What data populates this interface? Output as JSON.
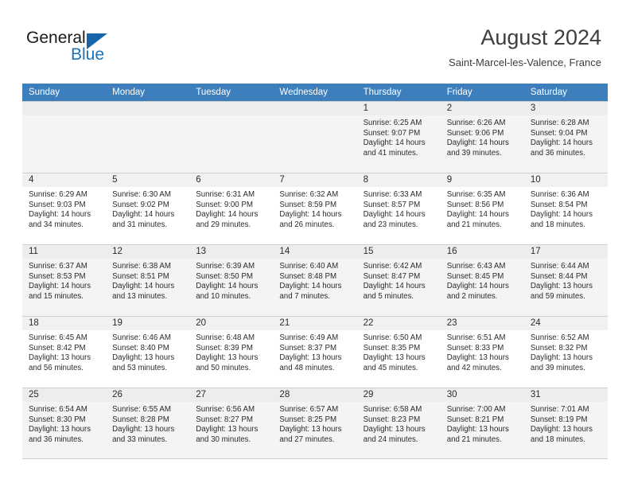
{
  "brand": {
    "name_part1": "General",
    "name_part2": "Blue",
    "accent_color": "#1c72b8"
  },
  "header": {
    "title": "August 2024",
    "location": "Saint-Marcel-les-Valence, France"
  },
  "calendar": {
    "header_bg": "#3d7ebd",
    "weekdays": [
      "Sunday",
      "Monday",
      "Tuesday",
      "Wednesday",
      "Thursday",
      "Friday",
      "Saturday"
    ],
    "weeks": [
      [
        {
          "day": "",
          "empty": true
        },
        {
          "day": "",
          "empty": true
        },
        {
          "day": "",
          "empty": true
        },
        {
          "day": "",
          "empty": true
        },
        {
          "day": "1",
          "sunrise": "Sunrise: 6:25 AM",
          "sunset": "Sunset: 9:07 PM",
          "daylight": "Daylight: 14 hours and 41 minutes."
        },
        {
          "day": "2",
          "sunrise": "Sunrise: 6:26 AM",
          "sunset": "Sunset: 9:06 PM",
          "daylight": "Daylight: 14 hours and 39 minutes."
        },
        {
          "day": "3",
          "sunrise": "Sunrise: 6:28 AM",
          "sunset": "Sunset: 9:04 PM",
          "daylight": "Daylight: 14 hours and 36 minutes."
        }
      ],
      [
        {
          "day": "4",
          "sunrise": "Sunrise: 6:29 AM",
          "sunset": "Sunset: 9:03 PM",
          "daylight": "Daylight: 14 hours and 34 minutes."
        },
        {
          "day": "5",
          "sunrise": "Sunrise: 6:30 AM",
          "sunset": "Sunset: 9:02 PM",
          "daylight": "Daylight: 14 hours and 31 minutes."
        },
        {
          "day": "6",
          "sunrise": "Sunrise: 6:31 AM",
          "sunset": "Sunset: 9:00 PM",
          "daylight": "Daylight: 14 hours and 29 minutes."
        },
        {
          "day": "7",
          "sunrise": "Sunrise: 6:32 AM",
          "sunset": "Sunset: 8:59 PM",
          "daylight": "Daylight: 14 hours and 26 minutes."
        },
        {
          "day": "8",
          "sunrise": "Sunrise: 6:33 AM",
          "sunset": "Sunset: 8:57 PM",
          "daylight": "Daylight: 14 hours and 23 minutes."
        },
        {
          "day": "9",
          "sunrise": "Sunrise: 6:35 AM",
          "sunset": "Sunset: 8:56 PM",
          "daylight": "Daylight: 14 hours and 21 minutes."
        },
        {
          "day": "10",
          "sunrise": "Sunrise: 6:36 AM",
          "sunset": "Sunset: 8:54 PM",
          "daylight": "Daylight: 14 hours and 18 minutes."
        }
      ],
      [
        {
          "day": "11",
          "sunrise": "Sunrise: 6:37 AM",
          "sunset": "Sunset: 8:53 PM",
          "daylight": "Daylight: 14 hours and 15 minutes."
        },
        {
          "day": "12",
          "sunrise": "Sunrise: 6:38 AM",
          "sunset": "Sunset: 8:51 PM",
          "daylight": "Daylight: 14 hours and 13 minutes."
        },
        {
          "day": "13",
          "sunrise": "Sunrise: 6:39 AM",
          "sunset": "Sunset: 8:50 PM",
          "daylight": "Daylight: 14 hours and 10 minutes."
        },
        {
          "day": "14",
          "sunrise": "Sunrise: 6:40 AM",
          "sunset": "Sunset: 8:48 PM",
          "daylight": "Daylight: 14 hours and 7 minutes."
        },
        {
          "day": "15",
          "sunrise": "Sunrise: 6:42 AM",
          "sunset": "Sunset: 8:47 PM",
          "daylight": "Daylight: 14 hours and 5 minutes."
        },
        {
          "day": "16",
          "sunrise": "Sunrise: 6:43 AM",
          "sunset": "Sunset: 8:45 PM",
          "daylight": "Daylight: 14 hours and 2 minutes."
        },
        {
          "day": "17",
          "sunrise": "Sunrise: 6:44 AM",
          "sunset": "Sunset: 8:44 PM",
          "daylight": "Daylight: 13 hours and 59 minutes."
        }
      ],
      [
        {
          "day": "18",
          "sunrise": "Sunrise: 6:45 AM",
          "sunset": "Sunset: 8:42 PM",
          "daylight": "Daylight: 13 hours and 56 minutes."
        },
        {
          "day": "19",
          "sunrise": "Sunrise: 6:46 AM",
          "sunset": "Sunset: 8:40 PM",
          "daylight": "Daylight: 13 hours and 53 minutes."
        },
        {
          "day": "20",
          "sunrise": "Sunrise: 6:48 AM",
          "sunset": "Sunset: 8:39 PM",
          "daylight": "Daylight: 13 hours and 50 minutes."
        },
        {
          "day": "21",
          "sunrise": "Sunrise: 6:49 AM",
          "sunset": "Sunset: 8:37 PM",
          "daylight": "Daylight: 13 hours and 48 minutes."
        },
        {
          "day": "22",
          "sunrise": "Sunrise: 6:50 AM",
          "sunset": "Sunset: 8:35 PM",
          "daylight": "Daylight: 13 hours and 45 minutes."
        },
        {
          "day": "23",
          "sunrise": "Sunrise: 6:51 AM",
          "sunset": "Sunset: 8:33 PM",
          "daylight": "Daylight: 13 hours and 42 minutes."
        },
        {
          "day": "24",
          "sunrise": "Sunrise: 6:52 AM",
          "sunset": "Sunset: 8:32 PM",
          "daylight": "Daylight: 13 hours and 39 minutes."
        }
      ],
      [
        {
          "day": "25",
          "sunrise": "Sunrise: 6:54 AM",
          "sunset": "Sunset: 8:30 PM",
          "daylight": "Daylight: 13 hours and 36 minutes."
        },
        {
          "day": "26",
          "sunrise": "Sunrise: 6:55 AM",
          "sunset": "Sunset: 8:28 PM",
          "daylight": "Daylight: 13 hours and 33 minutes."
        },
        {
          "day": "27",
          "sunrise": "Sunrise: 6:56 AM",
          "sunset": "Sunset: 8:27 PM",
          "daylight": "Daylight: 13 hours and 30 minutes."
        },
        {
          "day": "28",
          "sunrise": "Sunrise: 6:57 AM",
          "sunset": "Sunset: 8:25 PM",
          "daylight": "Daylight: 13 hours and 27 minutes."
        },
        {
          "day": "29",
          "sunrise": "Sunrise: 6:58 AM",
          "sunset": "Sunset: 8:23 PM",
          "daylight": "Daylight: 13 hours and 24 minutes."
        },
        {
          "day": "30",
          "sunrise": "Sunrise: 7:00 AM",
          "sunset": "Sunset: 8:21 PM",
          "daylight": "Daylight: 13 hours and 21 minutes."
        },
        {
          "day": "31",
          "sunrise": "Sunrise: 7:01 AM",
          "sunset": "Sunset: 8:19 PM",
          "daylight": "Daylight: 13 hours and 18 minutes."
        }
      ]
    ]
  }
}
